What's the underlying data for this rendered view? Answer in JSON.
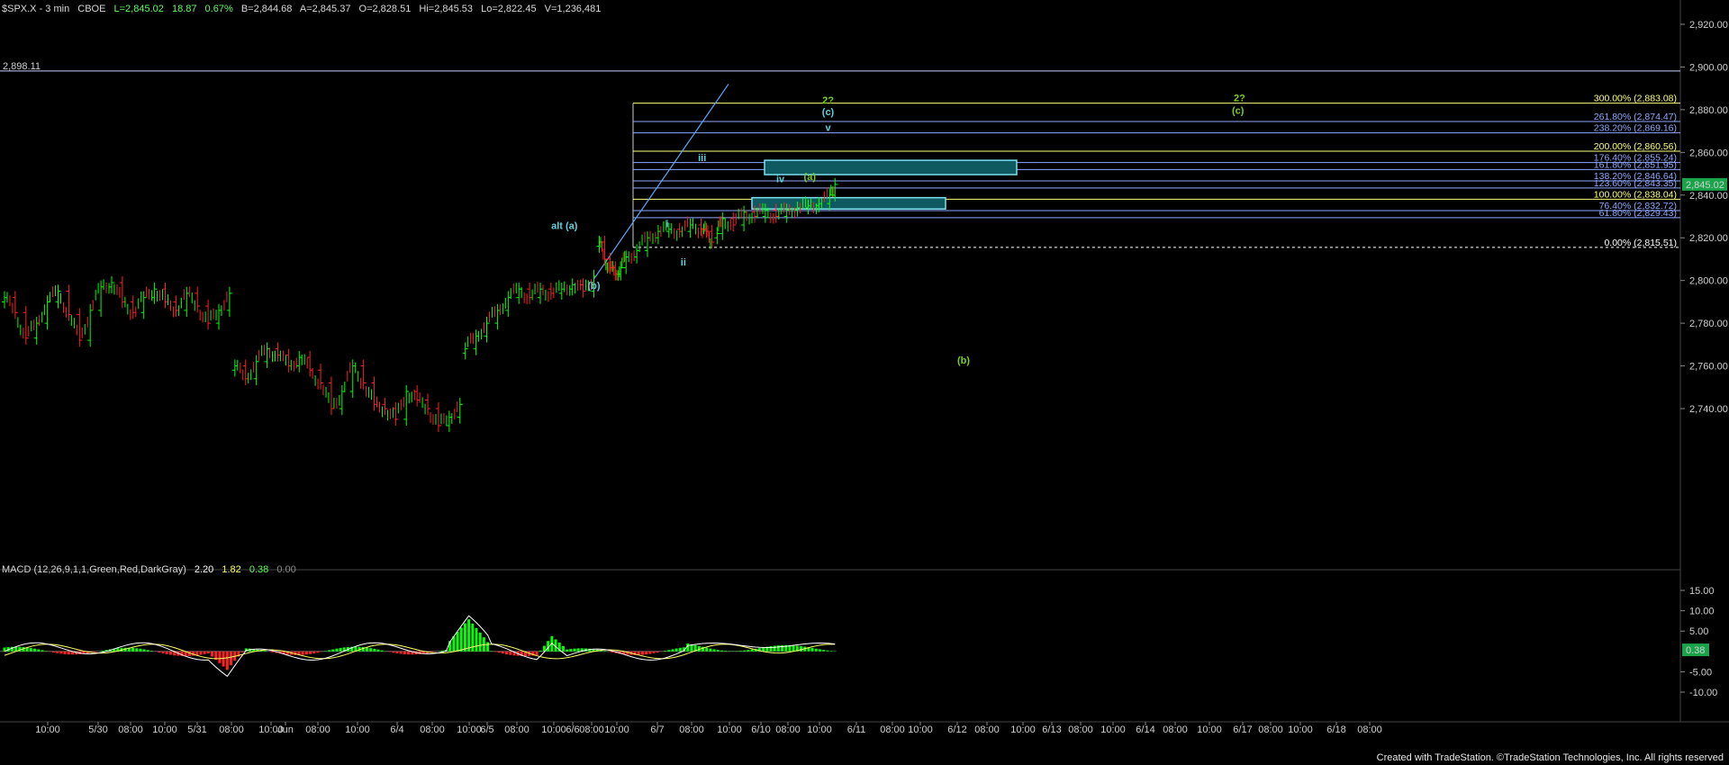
{
  "header": {
    "symbol": "$SPX.X - 3 min",
    "exchange": "CBOE",
    "last": "L=2,845.02",
    "change": "18.87",
    "change_pct": "0.67%",
    "bid": "B=2,844.68",
    "ask": "A=2,845.37",
    "open": "O=2,828.51",
    "high": "Hi=2,845.53",
    "low": "Lo=2,822.45",
    "volume": "V=1,236,481"
  },
  "colors": {
    "background": "#000000",
    "up_bar": "#00ff00",
    "down_bar": "#ff2020",
    "macd_line": "#ffffff",
    "signal_line": "#ffff66",
    "wave_cyan": "#5fd0e0",
    "wave_green": "#7ad020",
    "fib_blue": "#8fa8ff",
    "fib_yellow": "#ffff80",
    "fib_white": "#ffffff",
    "box_fill": "#0f5a60"
  },
  "footer": "Created with TradeStation. ©TradeStation Technologies, Inc. All rights reserved",
  "chart_data": [
    {
      "type": "candlestick",
      "ylim": [
        2722,
        2932
      ],
      "y_ticks": [
        "2,920.00",
        "2,900.00",
        "2,880.00",
        "2,860.00",
        "2,840.00",
        "2,820.00",
        "2,800.00",
        "2,780.00",
        "2,760.00",
        "2,740.00"
      ],
      "x_ticks": [
        "10:00",
        "5/30",
        "08:00",
        "10:00",
        "5/31",
        "08:00",
        "10:00",
        "Jun",
        "08:00",
        "10:00",
        "6/4",
        "08:00",
        "10:00",
        "6/5",
        "08:00",
        "10:00",
        "6/6",
        "08:00",
        "10:00",
        "6/7",
        "08:00",
        "10:00",
        "6/10",
        "08:00",
        "10:00",
        "6/11",
        "08:00",
        "10:00",
        "6/12",
        "08:00",
        "10:00",
        "6/13",
        "08:00",
        "10:00",
        "6/14",
        "08:00",
        "10:00",
        "6/17",
        "08:00",
        "10:00",
        "6/18",
        "08:00"
      ],
      "last_price_label": "2,845.02",
      "last_price": 2845.02,
      "series": [
        {
          "segment": "5/29-5/30",
          "values": [
            [
              0.0,
              2792
            ],
            [
              0.02,
              2785
            ],
            [
              0.04,
              2773
            ],
            [
              0.06,
              2780
            ],
            [
              0.08,
              2790
            ],
            [
              0.1,
              2795
            ],
            [
              0.12,
              2784
            ],
            [
              0.14,
              2772
            ],
            [
              0.16,
              2786
            ],
            [
              0.18,
              2797
            ],
            [
              0.2,
              2799
            ],
            [
              0.22,
              2790
            ],
            [
              0.24,
              2785
            ],
            [
              0.26,
              2792
            ],
            [
              0.28,
              2796
            ],
            [
              0.3,
              2790
            ],
            [
              0.32,
              2786
            ],
            [
              0.34,
              2794
            ],
            [
              0.36,
              2788
            ],
            [
              0.38,
              2780
            ],
            [
              0.4,
              2786
            ],
            [
              0.42,
              2794
            ]
          ]
        },
        {
          "segment": "5/31",
          "values": [
            [
              0.43,
              2760
            ],
            [
              0.45,
              2754
            ],
            [
              0.47,
              2762
            ],
            [
              0.49,
              2768
            ],
            [
              0.51,
              2765
            ],
            [
              0.53,
              2760
            ],
            [
              0.55,
              2764
            ],
            [
              0.57,
              2758
            ],
            [
              0.59,
              2752
            ],
            [
              0.61,
              2740
            ],
            [
              0.63,
              2748
            ],
            [
              0.65,
              2760
            ],
            [
              0.67,
              2752
            ],
            [
              0.69,
              2742
            ],
            [
              0.71,
              2740
            ],
            [
              0.73,
              2735
            ],
            [
              0.75,
              2748
            ],
            [
              0.77,
              2744
            ],
            [
              0.79,
              2740
            ],
            [
              0.81,
              2732
            ],
            [
              0.83,
              2736
            ],
            [
              0.85,
              2742
            ]
          ]
        },
        {
          "segment": "6/4",
          "values": [
            [
              0.86,
              2768
            ],
            [
              0.88,
              2774
            ],
            [
              0.9,
              2780
            ],
            [
              0.92,
              2786
            ],
            [
              0.94,
              2792
            ],
            [
              0.96,
              2796
            ],
            [
              0.98,
              2792
            ],
            [
              1.0,
              2796
            ],
            [
              1.02,
              2794
            ],
            [
              1.04,
              2796
            ],
            [
              1.06,
              2798
            ],
            [
              1.08,
              2795
            ],
            [
              1.1,
              2802
            ]
          ]
        },
        {
          "segment": "6/5",
          "values": [
            [
              1.11,
              2818
            ],
            [
              1.12,
              2810
            ],
            [
              1.13,
              2806
            ],
            [
              1.14,
              2803
            ],
            [
              1.15,
              2806
            ],
            [
              1.16,
              2811
            ],
            [
              1.18,
              2814
            ],
            [
              1.2,
              2820
            ],
            [
              1.22,
              2823
            ],
            [
              1.24,
              2824
            ],
            [
              1.26,
              2823
            ],
            [
              1.28,
              2826
            ],
            [
              1.3,
              2824
            ],
            [
              1.31,
              2823
            ],
            [
              1.32,
              2818
            ]
          ]
        },
        {
          "segment": "6/6",
          "values": [
            [
              1.33,
              2822
            ],
            [
              1.34,
              2829
            ],
            [
              1.36,
              2826
            ],
            [
              1.38,
              2832
            ],
            [
              1.4,
              2830
            ],
            [
              1.42,
              2833
            ],
            [
              1.44,
              2830
            ],
            [
              1.46,
              2833
            ],
            [
              1.48,
              2834
            ],
            [
              1.5,
              2835
            ],
            [
              1.52,
              2836
            ],
            [
              1.54,
              2840
            ],
            [
              1.55,
              2845
            ]
          ]
        }
      ]
    },
    {
      "type": "macd",
      "title": "MACD (12,26,9,1,1,Green,Red,DarkGray)",
      "values_text": [
        "2.20",
        "1.82",
        "0.38",
        "0.00"
      ],
      "value_label": "0.38",
      "ylim": [
        -14,
        16
      ],
      "y_ticks": [
        "15.00",
        "10.00",
        "5.00",
        "-5.00",
        "-10.00"
      ]
    }
  ],
  "fib_levels": [
    {
      "label": "300.00% (2,883.08)",
      "price": 2883.08,
      "color": "#ffff80"
    },
    {
      "label": "261.80% (2,874.47)",
      "price": 2874.47,
      "color": "#8fa8ff"
    },
    {
      "label": "238.20% (2,869.16)",
      "price": 2869.16,
      "color": "#8fa8ff"
    },
    {
      "label": "200.00% (2,860.56)",
      "price": 2860.56,
      "color": "#ffff80"
    },
    {
      "label": "176.40% (2,855.24)",
      "price": 2855.24,
      "color": "#8fa8ff"
    },
    {
      "label": "161.80% (2,851.95)",
      "price": 2851.95,
      "color": "#8fa8ff"
    },
    {
      "label": "138.20% (2,846.64)",
      "price": 2846.64,
      "color": "#8fa8ff"
    },
    {
      "label": "123.60% (2,843.35)",
      "price": 2843.35,
      "color": "#8fa8ff"
    },
    {
      "label": "100.00% (2,838.04)",
      "price": 2838.04,
      "color": "#ffff80"
    },
    {
      "label": "76.40% (2,832.72)",
      "price": 2832.72,
      "color": "#8fa8ff"
    },
    {
      "label": "61.80% (2,829.43)",
      "price": 2829.43,
      "color": "#8fa8ff"
    },
    {
      "label": "0.00% (2,815.51)",
      "price": 2815.51,
      "color": "#ffffff"
    }
  ],
  "horizontal_line": {
    "label": "2,898.11",
    "price": 2898.11
  },
  "wave_labels": [
    {
      "text": "alt (a)",
      "color": "#5fd0e0"
    },
    {
      "text": "(b)",
      "color": "#5fd0e0"
    },
    {
      "text": "i",
      "color": "#5fd0e0"
    },
    {
      "text": "ii",
      "color": "#5fd0e0"
    },
    {
      "text": "iii",
      "color": "#5fd0e0"
    },
    {
      "text": "iv",
      "color": "#5fd0e0"
    },
    {
      "text": "v",
      "color": "#5fd0e0"
    },
    {
      "text": "(a)",
      "color": "#7ad020"
    },
    {
      "text": "2?",
      "color": "#7ad020"
    },
    {
      "text": "(c)",
      "color": "#5fd0e0"
    },
    {
      "text": "2?",
      "color": "#7ad020"
    },
    {
      "text": "(c)",
      "color": "#7ad020"
    },
    {
      "text": "(b)",
      "color": "#7ad020"
    }
  ]
}
